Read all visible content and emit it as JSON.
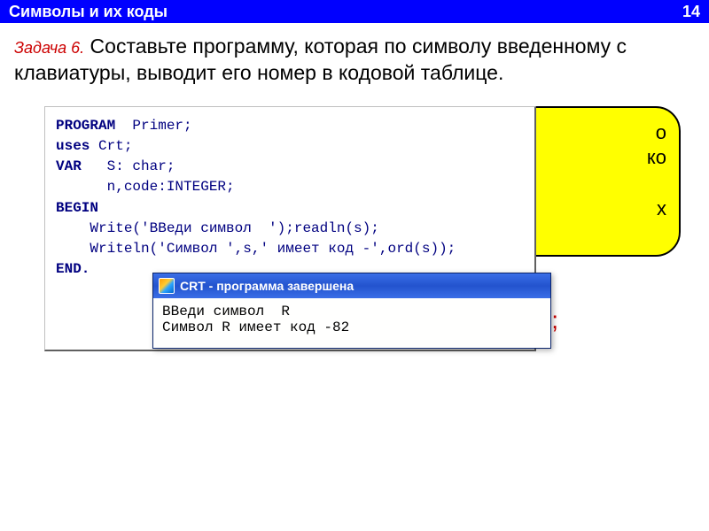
{
  "header": {
    "title": "Символы  и их коды",
    "page": "14"
  },
  "task": {
    "label": "Задача 6.",
    "text": " Составьте программу, которая по символу введенному с клавиатуры, выводит его номер в кодовой таблице."
  },
  "yellow_hint": {
    "line1": "о",
    "line2": "ко",
    "line3": "х"
  },
  "red_fragment": "));",
  "code": {
    "l1_kw": "PROGRAM",
    "l1_rest": "  Primer;",
    "l2_kw": "uses",
    "l2_rest": " Crt;",
    "l3_kw": "VAR",
    "l3_rest": "   S: char;",
    "l4": "      n,code:INTEGER;",
    "l5_kw": "BEGIN",
    "l6": "    Write('ВВеди символ  ');readln(s);",
    "l7": "    Writeln('Символ ',s,' имеет код -',ord(s));",
    "l8_kw": "END."
  },
  "crt": {
    "title": "CRT - программа завершена",
    "line1": "ВВеди символ  R",
    "line2": "Символ R имеет код -82"
  }
}
